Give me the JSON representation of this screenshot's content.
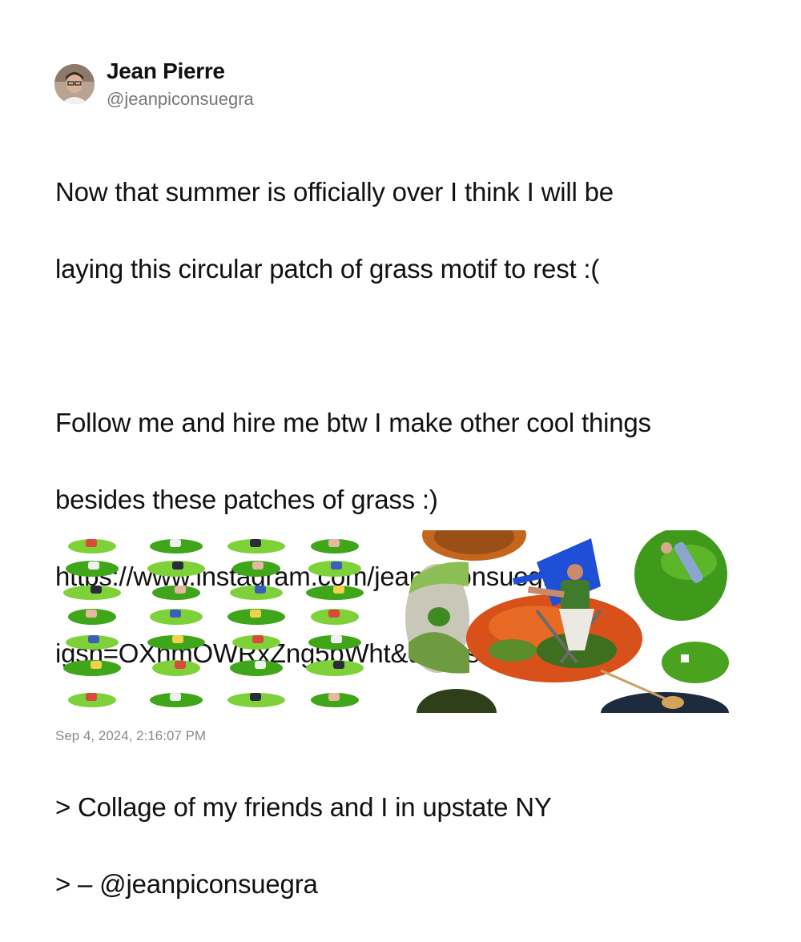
{
  "author": {
    "name": "Jean Pierre",
    "handle": "@jeanpiconsuegra",
    "avatar_icon": "profile-photo-avatar"
  },
  "tweet": {
    "line1": "Now that summer is officially over I think I will be",
    "line2": "laying this circular patch of grass motif to rest :(",
    "line3": "Follow me and hire me btw I make other cool things",
    "line4": "besides these patches of grass :)",
    "line5": "https://www.instagram.com/jeanpiconsuegra?",
    "line6": "igsh=OXhmOWRxZng5bWht&utm_source=qr",
    "line7": "> Collage of my friends and I in upstate NY",
    "line8": "> – @jeanpiconsuegra"
  },
  "media": {
    "left_image": "grid-of-grass-patch-collage",
    "right_image": "large-grass-patch-collage",
    "colors": {
      "grass": "#3fa61a",
      "grass_light": "#7fd13a",
      "chair_blue": "#1f4fd6",
      "flowers": "#e2521c"
    }
  },
  "timestamp": "Sep 4, 2024, 2:16:07 PM"
}
